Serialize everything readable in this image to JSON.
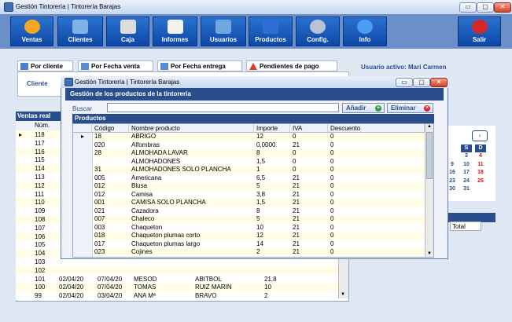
{
  "app": {
    "title": "Gestión Tintorería | Tintorería Barajas",
    "window_controls": [
      "▭",
      "▢",
      "✕"
    ]
  },
  "toolbar": {
    "buttons": [
      "Ventas",
      "Clientes",
      "Caja",
      "Informes",
      "Usuarios",
      "Productos",
      "Config.",
      "Info",
      "Salir"
    ]
  },
  "tabs": [
    "Por cliente",
    "Por Fecha venta",
    "Por Fecha entrega",
    "Pendientes de pago"
  ],
  "active_user": "Usuario activo: Mari Carmen",
  "cliente_label": "Cliente",
  "ventas": {
    "header": "Ventas real",
    "col_num": "Núm.",
    "rows": [
      {
        "num": "118"
      },
      {
        "num": "117"
      },
      {
        "num": "116"
      },
      {
        "num": "115"
      },
      {
        "num": "114"
      },
      {
        "num": "113"
      },
      {
        "num": "112"
      },
      {
        "num": "111"
      },
      {
        "num": "110"
      },
      {
        "num": "109"
      },
      {
        "num": "108"
      },
      {
        "num": "107"
      },
      {
        "num": "106"
      },
      {
        "num": "105"
      },
      {
        "num": "104"
      },
      {
        "num": "103"
      },
      {
        "num": "102"
      },
      {
        "num": "101",
        "fv": "02/04/20",
        "fe": "07/04/20",
        "nombre": "MESOD",
        "apellido": "ABITBOL",
        "total": "21,8"
      },
      {
        "num": "100",
        "fv": "02/04/20",
        "fe": "07/04/20",
        "nombre": "TOMAS",
        "apellido": "RUIZ MARIN",
        "total": "10"
      },
      {
        "num": "99",
        "fv": "02/04/20",
        "fe": "03/04/20",
        "nombre": "ANA Mª",
        "apellido": "BRAVO",
        "total": "2"
      }
    ]
  },
  "calendar": {
    "next": "›",
    "headers": [
      "S",
      "D"
    ],
    "days": [
      [
        "3",
        "4"
      ],
      [
        "10",
        "11"
      ],
      [
        "17",
        "18"
      ],
      [
        "24",
        "25"
      ],
      [
        "31",
        ""
      ]
    ],
    "extra_left": [
      "",
      "9",
      "16",
      "23",
      "30"
    ]
  },
  "total_label": "Total",
  "modal": {
    "title": "Gestión Tintorería | Tintorería Barajas",
    "header": "Gestión de los productos de la tintorería",
    "buscar_label": "Buscar",
    "buscar_value": "",
    "add_label": "Añadir",
    "delete_label": "Eliminar",
    "productos_label": "Productos",
    "columns": [
      "Código",
      "Nombre producto",
      "Importe",
      "IVA",
      "Descuento"
    ],
    "rows": [
      {
        "codigo": "18",
        "nombre": "ABRIGO",
        "importe": "12",
        "iva": "0",
        "descuento": "0"
      },
      {
        "codigo": "020",
        "nombre": "Alfombras",
        "importe": "0,0000",
        "iva": "21",
        "descuento": "0"
      },
      {
        "codigo": "28",
        "nombre": "ALMOHADA LAVAR",
        "importe": "8",
        "iva": "0",
        "descuento": "0"
      },
      {
        "codigo": "",
        "nombre": "ALMOHADONES",
        "importe": "1,5",
        "iva": "0",
        "descuento": "0"
      },
      {
        "codigo": "31",
        "nombre": "ALMOHADONES SOLO PLANCHA",
        "importe": "1",
        "iva": "0",
        "descuento": "0"
      },
      {
        "codigo": "005",
        "nombre": "Americana",
        "importe": "6,5",
        "iva": "21",
        "descuento": "0"
      },
      {
        "codigo": "012",
        "nombre": "Blusa",
        "importe": "5",
        "iva": "21",
        "descuento": "0"
      },
      {
        "codigo": "012",
        "nombre": "Camisa",
        "importe": "3,8",
        "iva": "21",
        "descuento": "0"
      },
      {
        "codigo": "001",
        "nombre": "CAMISA  SOLO PLANCHA",
        "importe": "1,5",
        "iva": "21",
        "descuento": "0"
      },
      {
        "codigo": "021",
        "nombre": "Cazadora",
        "importe": "8",
        "iva": "21",
        "descuento": "0"
      },
      {
        "codigo": "007",
        "nombre": "Chaleco",
        "importe": "5",
        "iva": "21",
        "descuento": "0"
      },
      {
        "codigo": "003",
        "nombre": "Chaqueton",
        "importe": "10",
        "iva": "21",
        "descuento": "0"
      },
      {
        "codigo": "018",
        "nombre": "Chaqueton plumas corto",
        "importe": "12",
        "iva": "21",
        "descuento": "0"
      },
      {
        "codigo": "017",
        "nombre": "Chaqueton plumas largo",
        "importe": "14",
        "iva": "21",
        "descuento": "0"
      },
      {
        "codigo": "023",
        "nombre": "Cojines",
        "importe": "2",
        "iva": "21",
        "descuento": "0"
      }
    ]
  },
  "colors": {
    "accent": "#2a4e8c",
    "toolbar_button": "#1a5bbd",
    "row_highlight": "#fffde6"
  }
}
